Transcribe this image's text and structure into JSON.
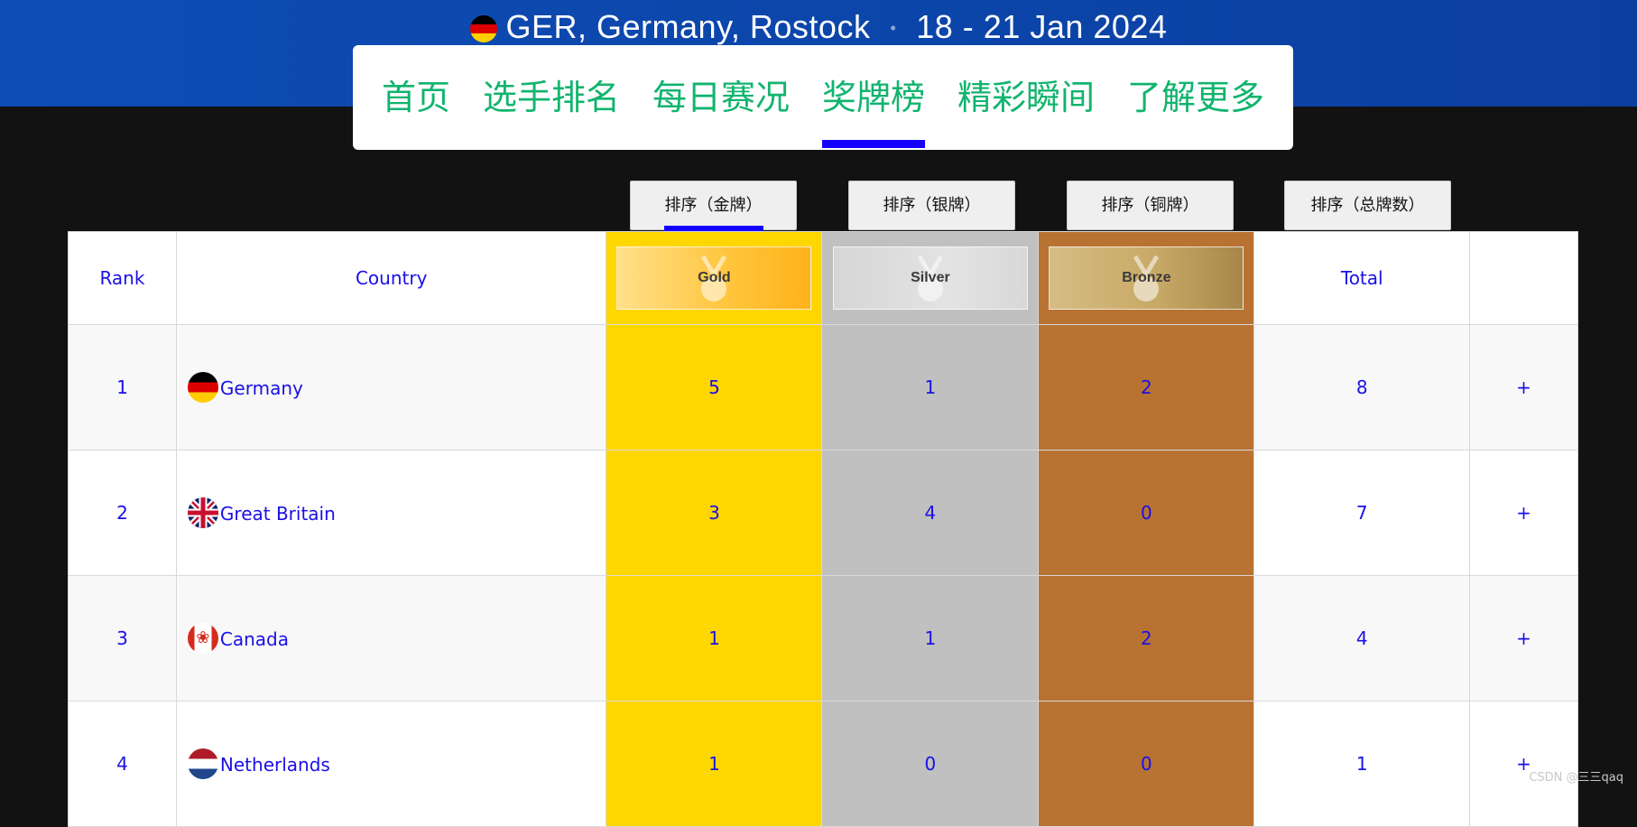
{
  "event": {
    "title": "GER, Germany, Rostock",
    "separator": "•",
    "dates": "18 - 21 Jan 2024"
  },
  "nav": {
    "items": [
      {
        "label": "首页"
      },
      {
        "label": "选手排名"
      },
      {
        "label": "每日赛况"
      },
      {
        "label": "奖牌榜",
        "active": true
      },
      {
        "label": "精彩瞬间"
      },
      {
        "label": "了解更多"
      }
    ]
  },
  "sort": {
    "gold": "排序（金牌）",
    "silver": "排序（银牌）",
    "bronze": "排序（铜牌）",
    "total": "排序（总牌数）",
    "active": "gold"
  },
  "table": {
    "headers": {
      "rank": "Rank",
      "country": "Country",
      "gold": "Gold",
      "silver": "Silver",
      "bronze": "Bronze",
      "total": "Total",
      "extra": ""
    },
    "rows": [
      {
        "rank": "1",
        "country": "Germany",
        "gold": "5",
        "silver": "1",
        "bronze": "2",
        "total": "8",
        "action": "+"
      },
      {
        "rank": "2",
        "country": "Great Britain",
        "gold": "3",
        "silver": "4",
        "bronze": "0",
        "total": "7",
        "action": "+"
      },
      {
        "rank": "3",
        "country": "Canada",
        "gold": "1",
        "silver": "1",
        "bronze": "2",
        "total": "4",
        "action": "+"
      },
      {
        "rank": "4",
        "country": "Netherlands",
        "gold": "1",
        "silver": "0",
        "bronze": "0",
        "total": "1",
        "action": "+"
      }
    ]
  },
  "colors": {
    "gold": "#ffd700",
    "silver": "#c0c0c0",
    "bronze": "#b87333",
    "nav_text": "#12b46e",
    "link_text": "#1a10e6",
    "active_indicator": "#1400ff",
    "header_band": "#0c4db6"
  },
  "icons": {
    "event_flag": "germany-flag-icon",
    "medal": "medal-icon"
  },
  "watermark": "CSDN @三三qaq"
}
